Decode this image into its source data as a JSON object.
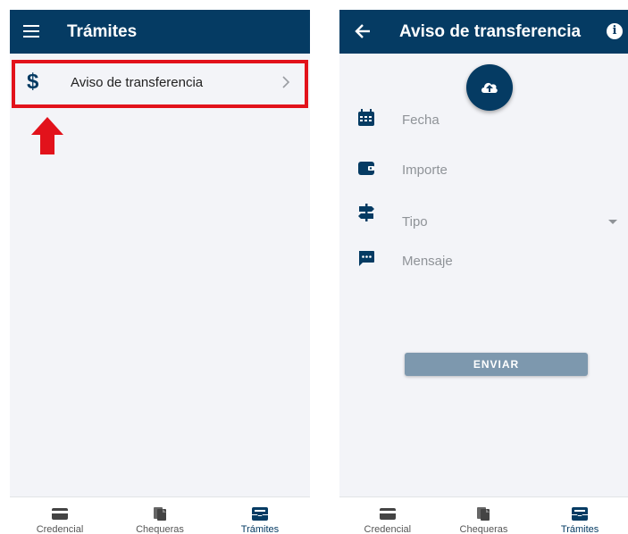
{
  "colors": {
    "primary": "#053b63",
    "background": "#f3f4f8",
    "highlight": "#e2121b",
    "button_disabled": "#7d98ae",
    "placeholder": "#8f9398"
  },
  "left_screen": {
    "header": {
      "title": "Trámites",
      "menu_icon": "hamburger-menu-icon"
    },
    "list_items": [
      {
        "label": "Aviso de transferencia",
        "icon": "dollar-icon",
        "trailing_icon": "chevron-right-icon"
      }
    ],
    "annotation": {
      "type": "red-box-and-arrow"
    }
  },
  "right_screen": {
    "header": {
      "title": "Aviso de transferencia",
      "back_icon": "arrow-back-icon",
      "info_icon": "info-icon"
    },
    "upload_icon": "cloud-upload-icon",
    "form": {
      "fecha_placeholder": "Fecha",
      "importe_placeholder": "Importe",
      "tipo_placeholder": "Tipo",
      "mensaje_placeholder": "Mensaje"
    },
    "submit_label": "ENVIAR"
  },
  "bottom_nav": {
    "items": [
      {
        "label": "Credencial",
        "icon": "card-icon"
      },
      {
        "label": "Chequeras",
        "icon": "documents-icon"
      },
      {
        "label": "Trámites",
        "icon": "inbox-icon",
        "active": true
      }
    ]
  }
}
